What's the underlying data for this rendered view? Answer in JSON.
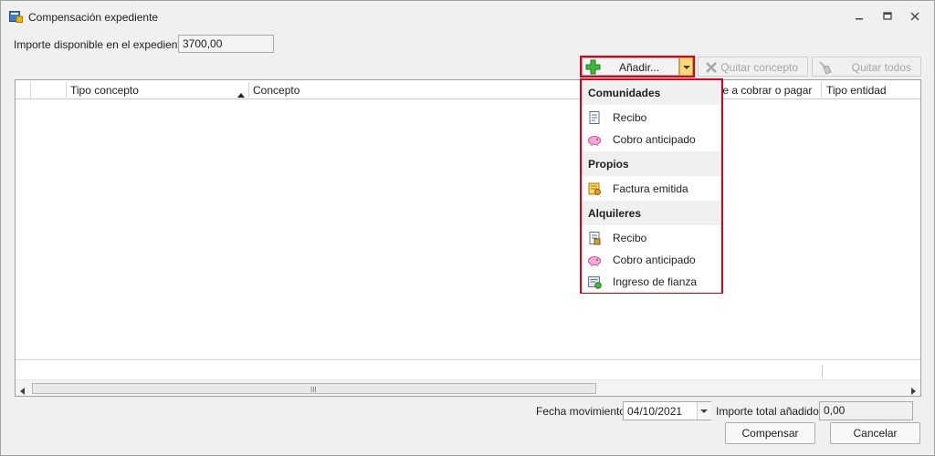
{
  "window": {
    "title": "Compensación expediente",
    "controls": [
      "minimize-icon",
      "restore-icon",
      "close-icon"
    ]
  },
  "available": {
    "label": "Importe disponible en el expediente:",
    "value": "3700,00"
  },
  "toolbar": {
    "add_label": "Añadir...",
    "remove_label": "Quitar concepto",
    "remove_all_label": "Quitar todos"
  },
  "grid": {
    "columns": [
      "Tipo concepto",
      "Concepto",
      "te a cobrar o pagar",
      "Tipo entidad"
    ],
    "sorted_column": "Tipo concepto",
    "sort_direction": "ascending",
    "scroll_grip": "III"
  },
  "add_menu": {
    "groups": [
      {
        "title": "Comunidades",
        "items": [
          {
            "label": "Recibo",
            "icon": "receipt-icon"
          },
          {
            "label": "Cobro anticipado",
            "icon": "piggy-bank-icon"
          }
        ]
      },
      {
        "title": "Propios",
        "items": [
          {
            "label": "Factura emitida",
            "icon": "invoice-icon"
          }
        ]
      },
      {
        "title": "Alquileres",
        "items": [
          {
            "label": "Recibo",
            "icon": "receipt-icon"
          },
          {
            "label": "Cobro anticipado",
            "icon": "piggy-bank-icon"
          },
          {
            "label": "Ingreso de fianza",
            "icon": "deposit-icon"
          }
        ]
      }
    ]
  },
  "footer": {
    "date_label": "Fecha movimiento:",
    "date_value": "04/10/2021",
    "total_label": "Importe total añadido:",
    "total_value": "0,00",
    "compensate_label": "Compensar",
    "cancel_label": "Cancelar"
  },
  "colors": {
    "highlight_border": "#d6001c",
    "dropdown_accent": "#fbd97a",
    "disabled_text": "#a6a6a6"
  }
}
